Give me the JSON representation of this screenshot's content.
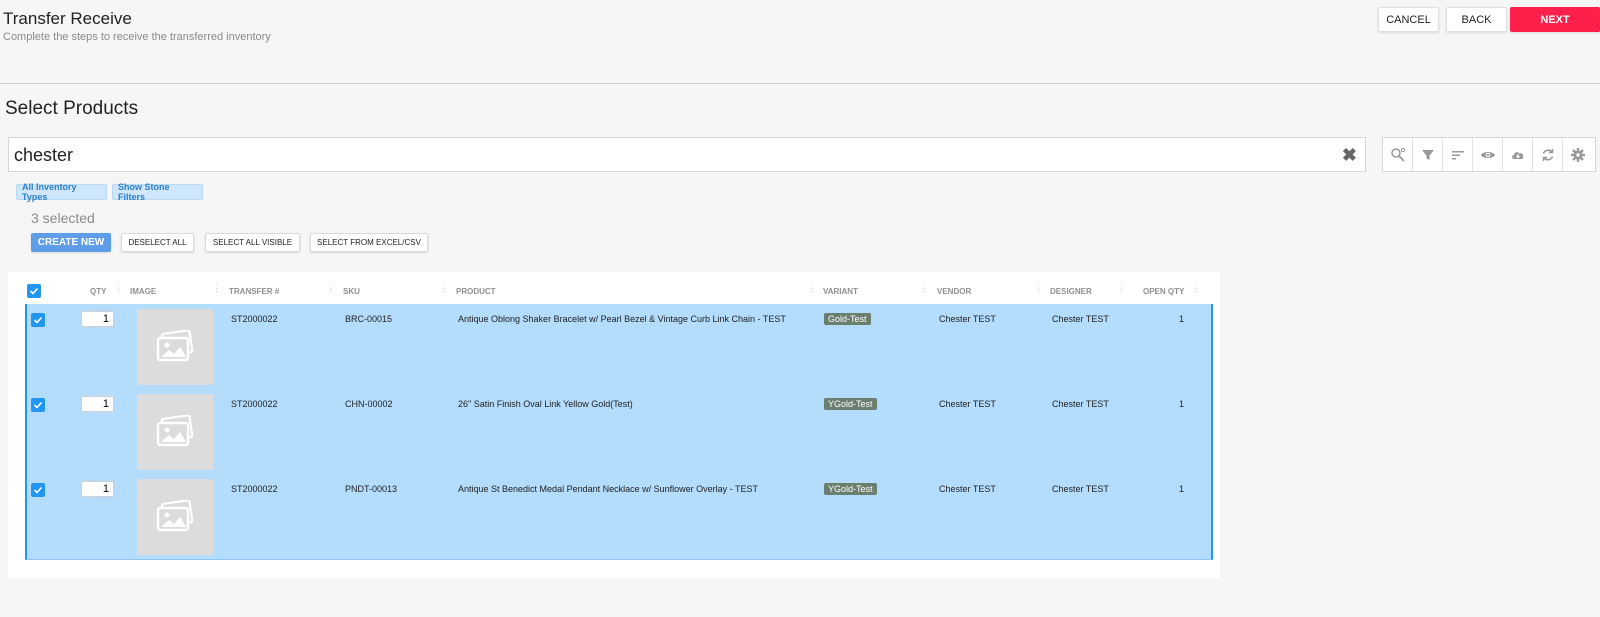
{
  "header": {
    "title": "Transfer Receive",
    "subtitle": "Complete the steps to receive the transferred inventory",
    "cancel_label": "CANCEL",
    "back_label": "BACK",
    "next_label": "NEXT"
  },
  "section_title": "Select Products",
  "search": {
    "value": "chester"
  },
  "toolbar": [
    "search-settings-icon",
    "filter-icon",
    "sort-icon",
    "eye-icon",
    "cloud-download-icon",
    "refresh-icon",
    "gear-icon"
  ],
  "filters": {
    "inventory_types": "All Inventory Types",
    "stone_filters": "Show Stone Filters"
  },
  "selected_count": "3 selected",
  "actions": {
    "create_new": "CREATE NEW",
    "deselect_all": "DESELECT ALL",
    "select_all_visible": "SELECT ALL VISIBLE",
    "select_from_excel": "SELECT FROM EXCEL/CSV"
  },
  "table": {
    "columns": [
      "QTY",
      "IMAGE",
      "TRANSFER #",
      "SKU",
      "PRODUCT",
      "VARIANT",
      "VENDOR",
      "DESIGNER",
      "OPEN QTY"
    ],
    "rows": [
      {
        "qty": "1",
        "transfer": "ST2000022",
        "sku": "BRC-00015",
        "product": "Antique Oblong Shaker Bracelet w/ Pearl Bezel & Vintage Curb Link Chain - TEST",
        "variant": "Gold-Test",
        "vendor": "Chester TEST",
        "designer": "Chester TEST",
        "open_qty": "1"
      },
      {
        "qty": "1",
        "transfer": "ST2000022",
        "sku": "CHN-00002",
        "product": "26\" Satin Finish Oval Link Yellow Gold(Test)",
        "variant": "YGold-Test",
        "vendor": "Chester TEST",
        "designer": "Chester TEST",
        "open_qty": "1"
      },
      {
        "qty": "1",
        "transfer": "ST2000022",
        "sku": "PNDT-00013",
        "product": "Antique St Benedict Medal Pendant Necklace w/ Sunflower Overlay - TEST",
        "variant": "YGold-Test",
        "vendor": "Chester TEST",
        "designer": "Chester TEST",
        "open_qty": "1"
      }
    ]
  },
  "colors": {
    "accent": "#2196f3",
    "next": "#ff1f4b",
    "selected_row": "#b3dcfd",
    "create": "#5e9de8"
  }
}
